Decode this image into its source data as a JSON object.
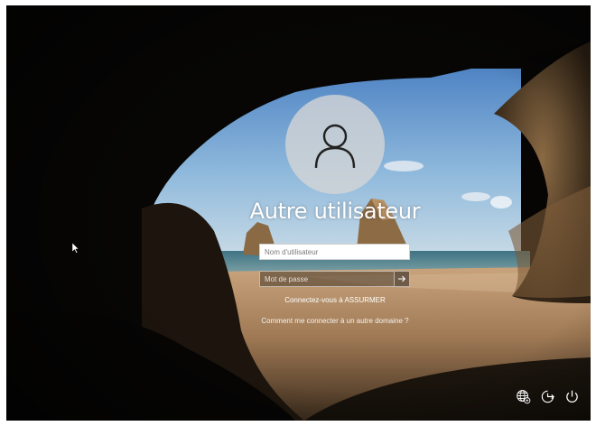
{
  "lock_screen": {
    "user_name": "Autre utilisateur",
    "username_placeholder": "Nom d'utilisateur",
    "password_placeholder": "Mot de passe",
    "domain_text": "Connectez-vous à ASSURMER",
    "other_domain_link": "Comment me connecter à un autre domaine ?"
  },
  "icons": {
    "avatar": "user-icon",
    "submit": "arrow-right-icon",
    "language": "globe-accessibility-icon",
    "ease_of_access": "ease-of-access-icon",
    "power": "power-icon",
    "cursor": "mouse-pointer-icon"
  },
  "colors": {
    "text": "#ffffff",
    "avatar_bg": "#d6d6d6",
    "background_dark": "#060504"
  }
}
